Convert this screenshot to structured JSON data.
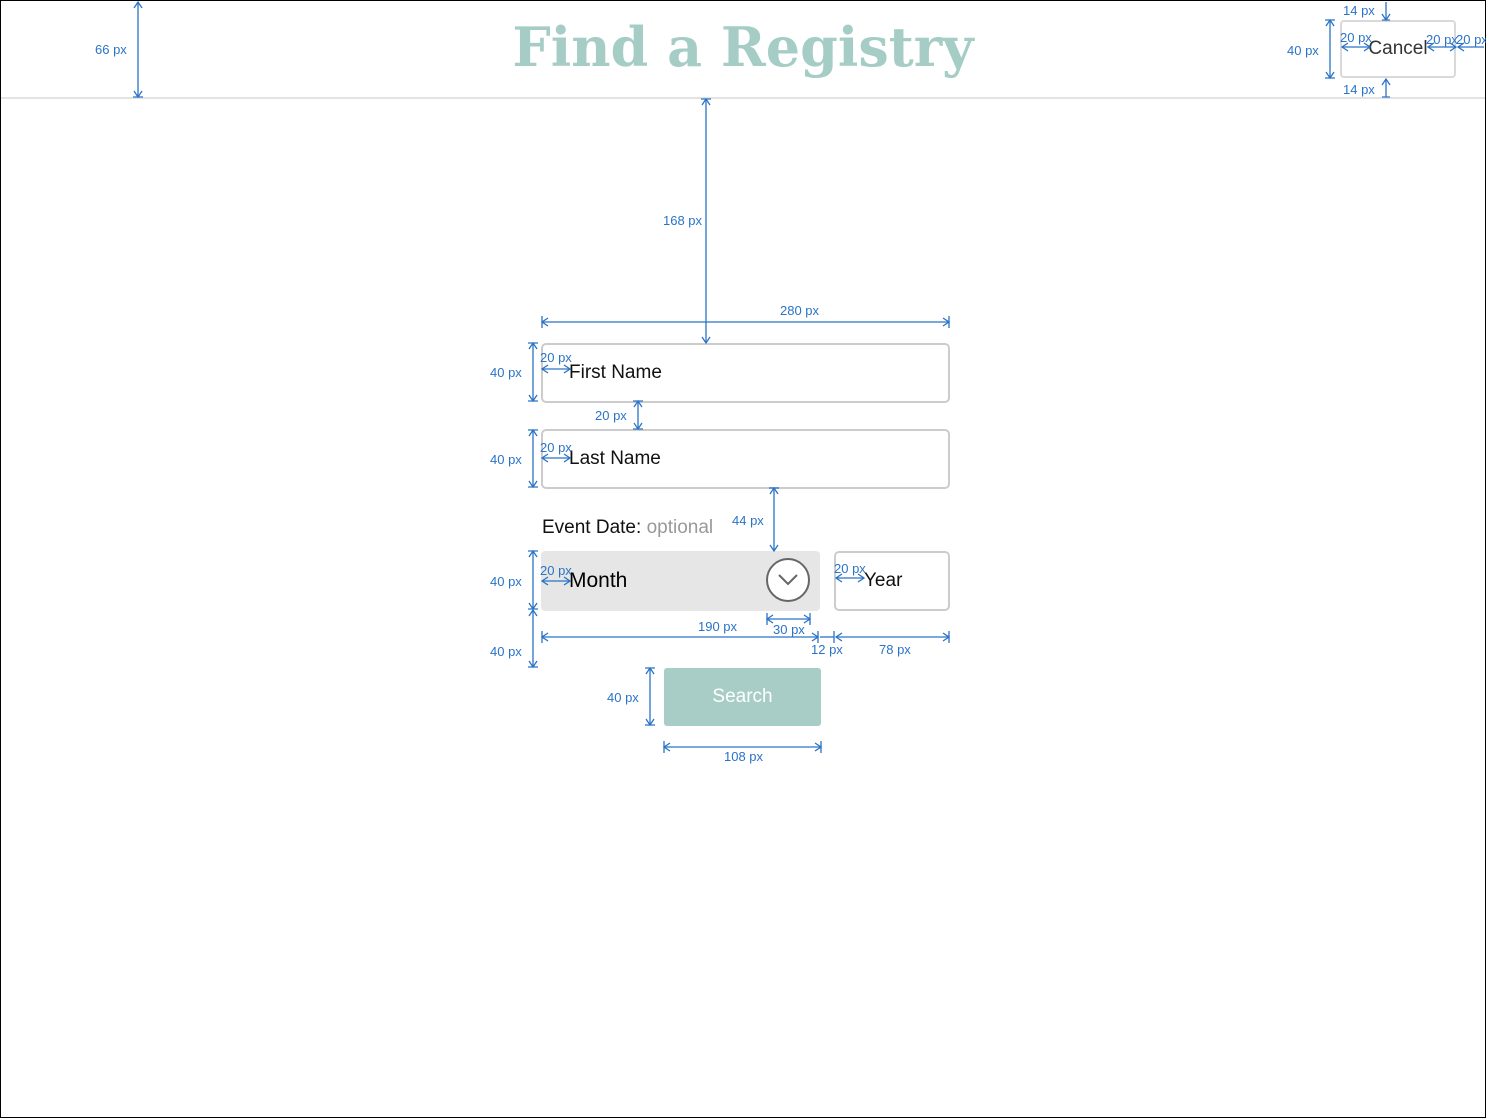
{
  "header": {
    "title": "Find a Registry",
    "cancel_label": "Cancel"
  },
  "form": {
    "first_name_placeholder": "First Name",
    "last_name_placeholder": "Last Name",
    "event_date_label": "Event Date:",
    "event_date_optional": "optional",
    "month_value": "Month",
    "year_placeholder": "Year",
    "search_label": "Search"
  },
  "annotations": {
    "header_height": "66 px",
    "cancel_top": "14 px",
    "cancel_bottom": "14 px",
    "cancel_height": "40 px",
    "cancel_pad_left": "20 px",
    "cancel_pad_right": "20 px",
    "cancel_margin_right": "20 px",
    "gap_to_form": "168 px",
    "form_width": "280 px",
    "first_height": "40 px",
    "first_pad": "20 px",
    "field_gap": "20 px",
    "last_height": "40 px",
    "last_pad": "20 px",
    "gap_to_month": "44 px",
    "month_height": "40 px",
    "month_pad": "20 px",
    "year_pad": "20 px",
    "month_width": "190 px",
    "chevron_width": "30 px",
    "select_gap": "12 px",
    "year_width": "78 px",
    "gap_to_search": "40 px",
    "search_height": "40 px",
    "search_width": "108 px"
  },
  "colors": {
    "accent": "#a8cdc6",
    "measure": "#2a73c7",
    "select_bg": "#e6e6e6",
    "border": "#cccccc"
  }
}
